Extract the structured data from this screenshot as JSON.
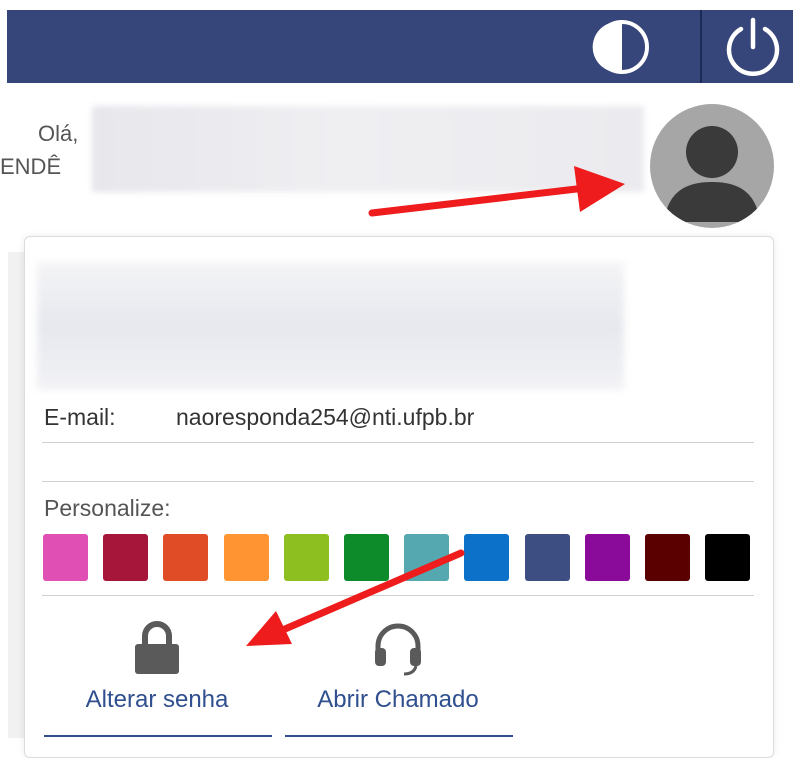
{
  "header": {
    "contrast_icon": "contrast-icon",
    "power_icon": "power-icon",
    "bar_color": "#36457a"
  },
  "greeting": {
    "hello": "Olá,",
    "name_fragment": "ENDÊ"
  },
  "profile": {
    "avatar_icon": "user-avatar-icon",
    "email_label": "E-mail:",
    "email_value": "naoresponda254@nti.ufpb.br"
  },
  "personalize": {
    "label": "Personalize:",
    "swatches": [
      "#e04fb3",
      "#a6163a",
      "#e04c26",
      "#ff9433",
      "#8cbf1f",
      "#0d8a2a",
      "#56a8b0",
      "#0c72c9",
      "#3d4f82",
      "#8a0a9a",
      "#5a0000",
      "#000000"
    ]
  },
  "actions": {
    "change_password": {
      "label": "Alterar senha",
      "icon": "lock-icon"
    },
    "open_ticket": {
      "label": "Abrir Chamado",
      "icon": "headset-icon"
    }
  },
  "annotations": {
    "arrow_color": "#ee1c1c"
  }
}
